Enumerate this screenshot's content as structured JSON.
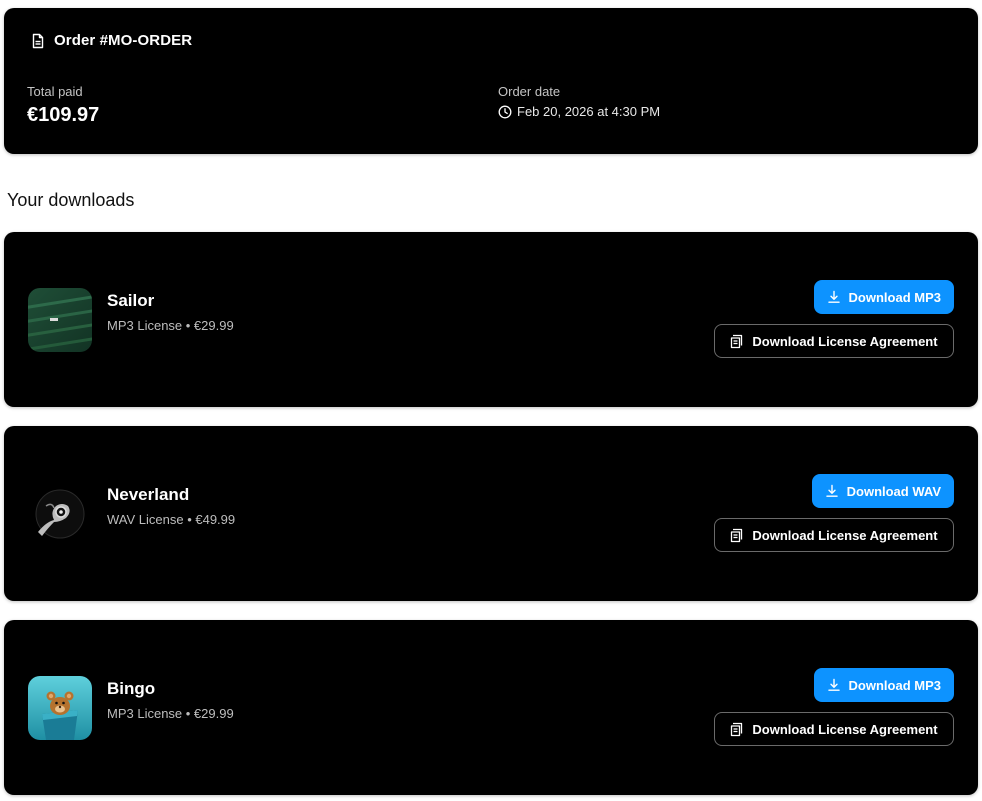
{
  "order": {
    "title": "Order #MO-ORDER",
    "total_label": "Total paid",
    "total_value": "€109.97",
    "date_label": "Order date",
    "date_value": "Feb 20, 2026 at 4:30 PM"
  },
  "downloads_heading": "Your downloads",
  "items": [
    {
      "title": "Sailor",
      "meta": "MP3 License • €29.99",
      "primary_label": "Download MP3",
      "license_label": "Download License Agreement"
    },
    {
      "title": "Neverland",
      "meta": "WAV License • €49.99",
      "primary_label": "Download WAV",
      "license_label": "Download License Agreement"
    },
    {
      "title": "Bingo",
      "meta": "MP3 License • €29.99",
      "primary_label": "Download MP3",
      "license_label": "Download License Agreement"
    }
  ],
  "colors": {
    "card_bg": "#000000",
    "accent": "#0d93ff",
    "muted_text": "#bdbdbd"
  },
  "icons": [
    "document-icon",
    "clock-icon",
    "download-icon",
    "license-icon"
  ]
}
